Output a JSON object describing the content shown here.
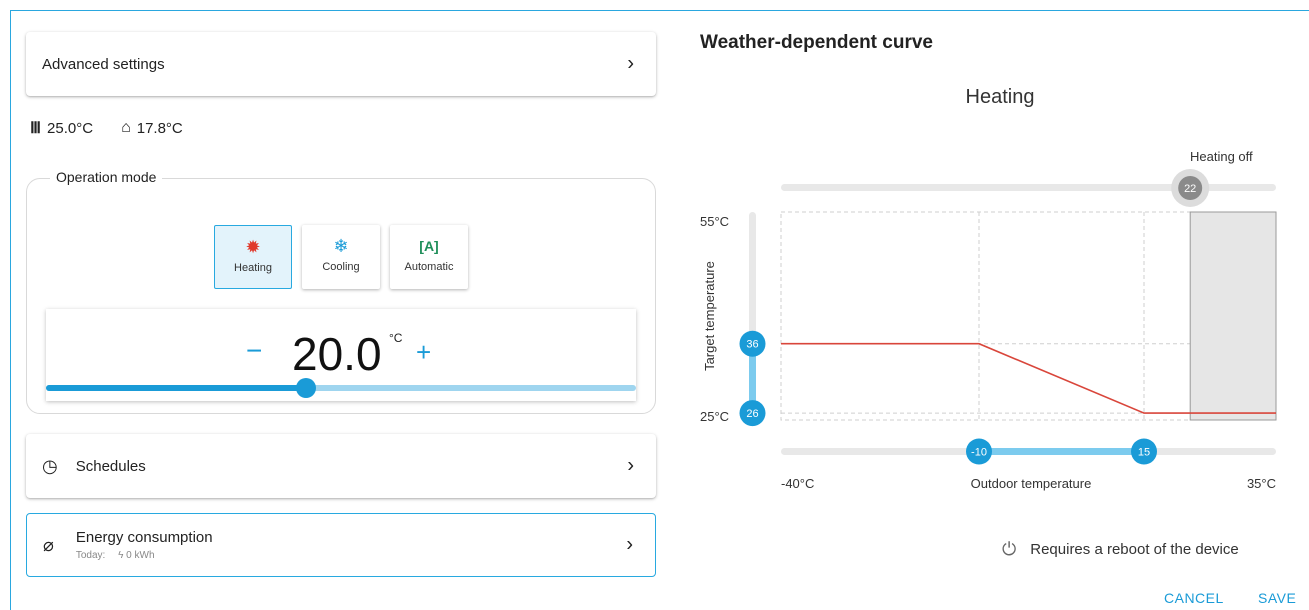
{
  "left": {
    "advanced_settings": "Advanced settings",
    "temps": {
      "flow": "25.0°C",
      "room": "17.8°C"
    },
    "operation_mode": {
      "title": "Operation mode",
      "modes": [
        {
          "label": "Heating",
          "icon": "sun-icon",
          "active": true
        },
        {
          "label": "Cooling",
          "icon": "snowflake-icon",
          "active": false
        },
        {
          "label": "Automatic",
          "icon": "auto-icon",
          "active": false
        }
      ],
      "setpoint": {
        "minus": "−",
        "value": "20.0",
        "unit": "°C",
        "plus": "+",
        "slider_fraction": 0.44
      }
    },
    "schedules": "Schedules",
    "energy": {
      "label": "Energy consumption",
      "today_label": "Today:",
      "today_value": "0 kWh"
    }
  },
  "right": {
    "title": "Weather-dependent curve",
    "chart_title": "Heating",
    "heating_off_label": "Heating off",
    "chart_data": {
      "type": "line",
      "title": "Heating",
      "xlabel": "Outdoor temperature",
      "ylabel": "Target temperature",
      "x_tick_labels": [
        "-40°C",
        "35°C"
      ],
      "y_tick_labels": [
        "55°C",
        "25°C"
      ],
      "xlim": [
        -40,
        35
      ],
      "ylim": [
        25,
        55
      ],
      "series": [
        {
          "x": [
            -40,
            -10,
            15,
            35
          ],
          "y": [
            36,
            36,
            26,
            26
          ]
        }
      ],
      "sliders": {
        "heating_off": 22,
        "target_high": 36,
        "target_low": 26,
        "outdoor_low": -10,
        "outdoor_high": 15
      },
      "grid": true,
      "colors": {
        "curve": "#d9463b",
        "accent": "#1a9bd7",
        "shade": "#e6e6e6"
      }
    },
    "reboot_note": "Requires a reboot of the device",
    "cancel": "CANCEL",
    "save": "SAVE"
  }
}
